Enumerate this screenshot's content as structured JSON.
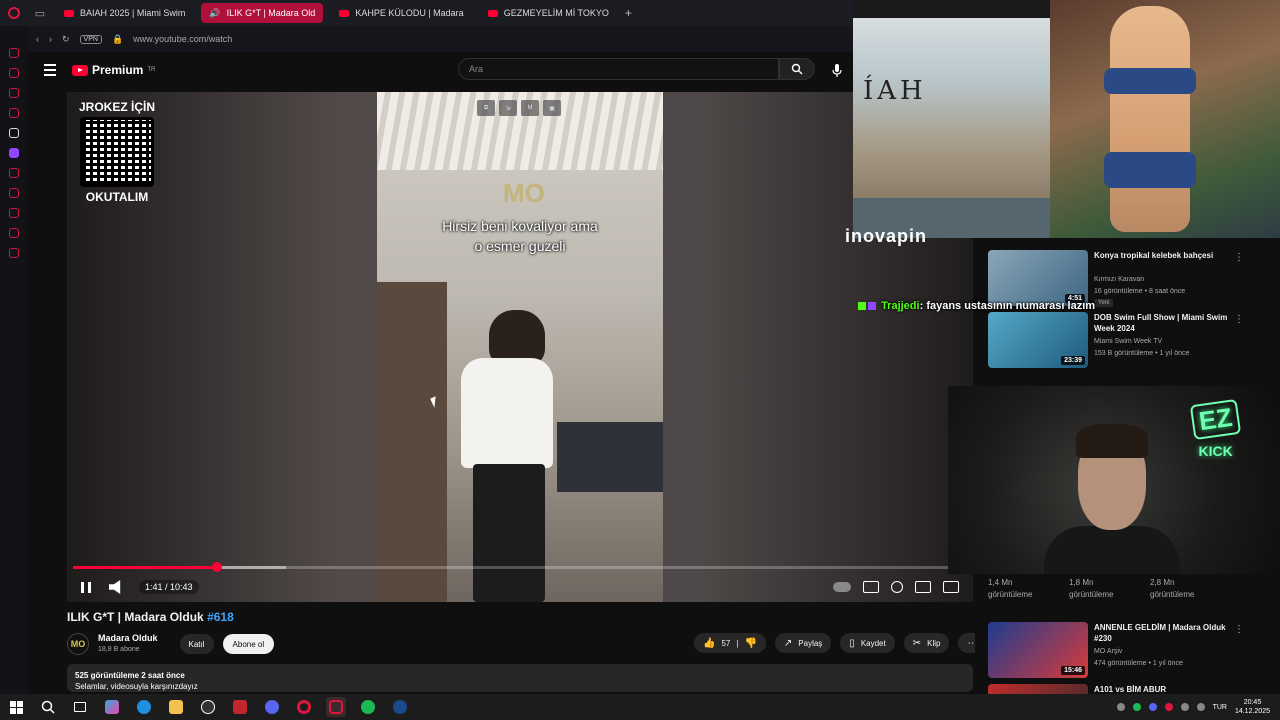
{
  "browser": {
    "tabs": [
      {
        "label": "BAIAH 2025 | Miami Swim",
        "active": false
      },
      {
        "label": "ILIK G*T | Madara Old",
        "active": true
      },
      {
        "label": "KAHPE KÜLODU | Madara",
        "active": false
      },
      {
        "label": "GEZMEYELİM Mİ TOKYO",
        "active": false
      }
    ],
    "vpn_label": "VPN",
    "url": "www.youtube.com/watch"
  },
  "youtube": {
    "logo_text": "Premium",
    "logo_region": "TR",
    "search_placeholder": "Ara"
  },
  "player": {
    "qr_title": "JROKEZ İÇİN",
    "qr_caption": "OKUTALIM",
    "caption_line1": "Hirsiz beni kovaliyor ama",
    "caption_line2": "o esmer guzeli",
    "watermark": "MO",
    "time": "1:41 / 10:43",
    "progress": 0.161,
    "buffered": 0.238
  },
  "video": {
    "title": "ILIK G*T | Madara Olduk",
    "hashtag": "#618",
    "channel_name": "Madara Olduk",
    "channel_avatar": "MO",
    "subscribers": "18,8 B abone",
    "join_label": "Katıl",
    "subscribe_label": "Abone ol",
    "likes": "57",
    "share_label": "Paylaş",
    "save_label": "Kaydet",
    "clip_label": "Klip",
    "views_meta": "525 görüntüleme  2 saat önce",
    "description": "Selamlar, videosuyla karşınızdayız"
  },
  "overlay": {
    "pip_text": "ÍAH",
    "partial_logo": "inovapin",
    "chat_user": "Trajjedi",
    "chat_message": ": fayans ustasının numarası lazım",
    "ez_label": "EZ",
    "kick_label": "KICK"
  },
  "recommendations": [
    {
      "title": "Konya tropikal kelebek bahçesi",
      "channel": "Kırmızı Karavan",
      "meta": "16 görüntüleme • 8 saat önce",
      "badge": "Yeni",
      "duration": "4:51"
    },
    {
      "title": "DOB Swim Full Show | Miami Swim Week 2024",
      "channel": "Miami Swim Week TV",
      "meta": "153 B görüntüleme • 1 yıl önce",
      "duration": "23:39"
    },
    {
      "title": "ANNENLE GELDİM | Madara Olduk #230",
      "channel": "MO Arşiv",
      "meta": "474 görüntüleme • 1 yıl önce",
      "duration": "15:46"
    },
    {
      "title": "A101 vs BİM ABUR",
      "channel": "",
      "meta": "",
      "duration": ""
    }
  ],
  "views_row": [
    {
      "count": "1,4 Mn",
      "label": "görüntüleme"
    },
    {
      "count": "1,8 Mn",
      "label": "görüntüleme"
    },
    {
      "count": "2,8 Mn",
      "label": "görüntüleme"
    }
  ],
  "taskbar": {
    "language": "TUR",
    "time": "20:45",
    "date": "14.12.2025"
  }
}
